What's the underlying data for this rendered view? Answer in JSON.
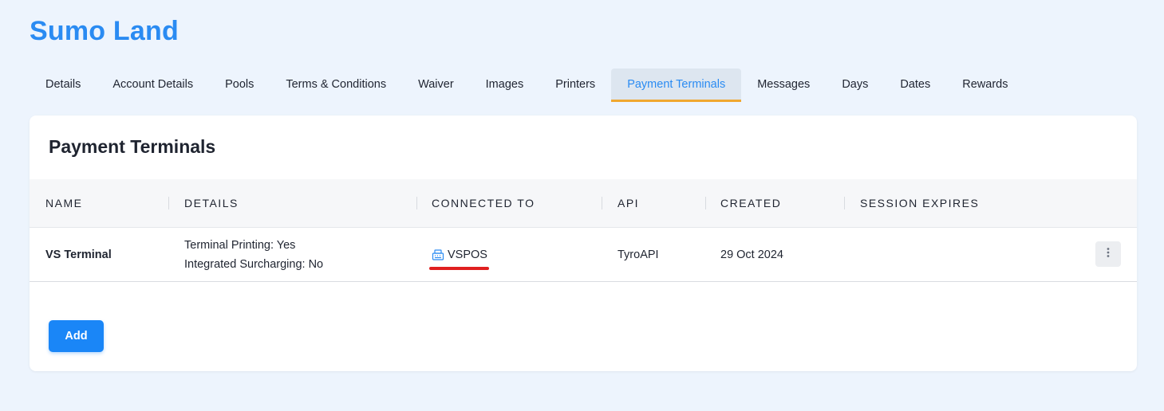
{
  "app": {
    "title": "Sumo Land"
  },
  "tabs": [
    {
      "label": "Details",
      "active": false
    },
    {
      "label": "Account Details",
      "active": false
    },
    {
      "label": "Pools",
      "active": false
    },
    {
      "label": "Terms & Conditions",
      "active": false
    },
    {
      "label": "Waiver",
      "active": false
    },
    {
      "label": "Images",
      "active": false
    },
    {
      "label": "Printers",
      "active": false
    },
    {
      "label": "Payment Terminals",
      "active": true
    },
    {
      "label": "Messages",
      "active": false
    },
    {
      "label": "Days",
      "active": false
    },
    {
      "label": "Dates",
      "active": false
    },
    {
      "label": "Rewards",
      "active": false
    }
  ],
  "section": {
    "title": "Payment Terminals",
    "columns": [
      "NAME",
      "DETAILS",
      "CONNECTED TO",
      "API",
      "CREATED",
      "SESSION EXPIRES"
    ],
    "rows": [
      {
        "name": "VS Terminal",
        "details_line1": "Terminal Printing: Yes",
        "details_line2": "Integrated Surcharging: No",
        "connected_to": "VSPOS",
        "connected_icon": "cash-register-icon",
        "api": "TyroAPI",
        "created": "29 Oct 2024",
        "session_expires": ""
      }
    ],
    "add_label": "Add"
  },
  "colors": {
    "brand": "#2a8bf2",
    "active_tab_underline": "#f0a830",
    "highlight_mark": "#e02020",
    "primary_button": "#1a86f7",
    "page_background": "#edf4fd"
  }
}
